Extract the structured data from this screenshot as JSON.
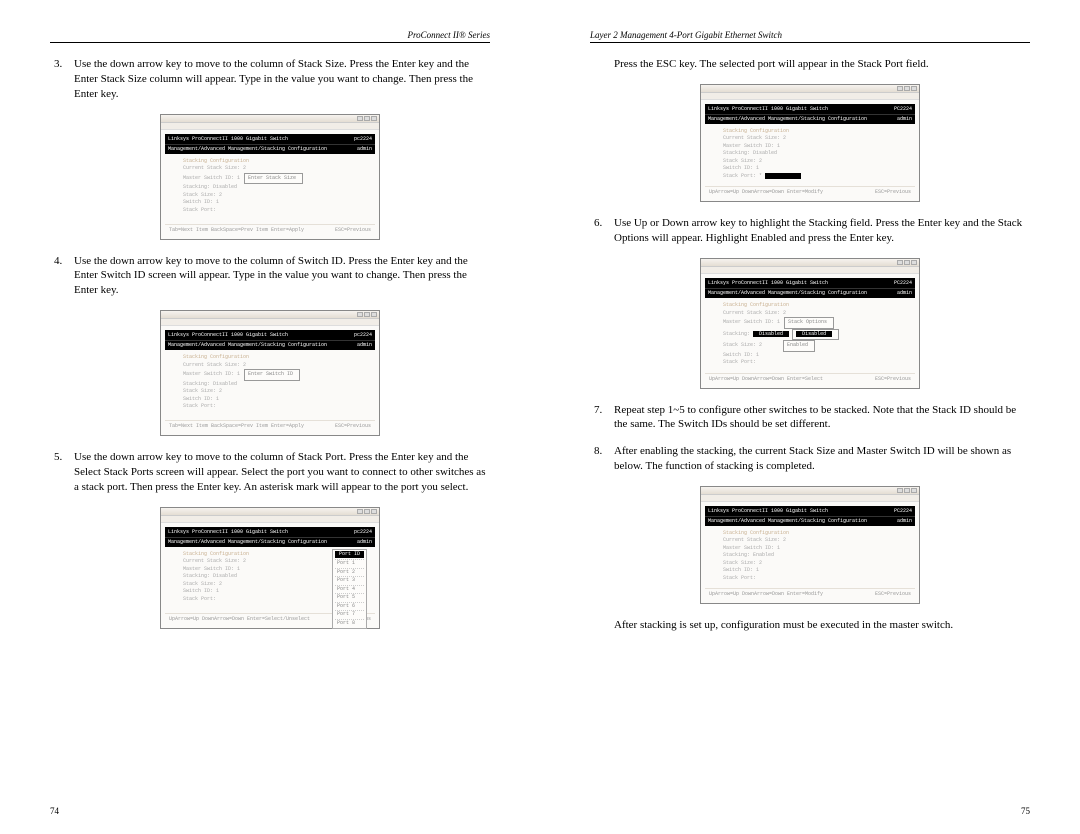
{
  "leftPage": {
    "header": "ProConnect II® Series",
    "pageNumber": "74",
    "steps": [
      {
        "n": "3.",
        "text": "Use the down arrow key to move to the column of Stack Size. Press the Enter key and the Enter Stack Size column will appear. Type in the value you want to change. Then press the Enter key."
      },
      {
        "n": "4.",
        "text": "Use the down arrow key to move to the column of Switch ID. Press the Enter key and the Enter Switch ID screen will appear. Type in the value you want to change. Then press the Enter key."
      },
      {
        "n": "5.",
        "text": "Use the down arrow key to move to the column of Stack Port. Press the Enter key and the Select Stack Ports screen will appear. Select the port you want to connect to other switches as a stack port. Then press the Enter key. An asterisk mark will appear to the port you select."
      }
    ],
    "screens": {
      "s3": {
        "titleLeft": "Linksys ProConnectII 1000 Gigabit Switch",
        "titleRight": "pc2224",
        "sub": "Management/Advanced Management/Stacking Configuration",
        "subRight": "admin",
        "heading": "Stacking Configuration",
        "lines": [
          "Current Stack Size: 2",
          "Master Switch ID:  1"
        ],
        "popup": "Enter Stack Size",
        "lines2": [
          "Stacking: Disabled",
          "Stack Size: 2",
          "Switch ID: 1",
          "Stack Port:"
        ],
        "footLeft": "Tab=Next Item  BackSpace=Prev Item  Enter=Apply",
        "footRight": "ESC=Previous"
      },
      "s4": {
        "titleLeft": "Linksys ProConnectII 1000 Gigabit Switch",
        "titleRight": "pc2224",
        "sub": "Management/Advanced Management/Stacking Configuration",
        "subRight": "admin",
        "heading": "Stacking Configuration",
        "lines": [
          "Current Stack Size: 2",
          "Master Switch ID:  1"
        ],
        "popup": "Enter Switch ID",
        "lines2": [
          "Stacking: Disabled",
          "Stack Size: 2",
          "Switch ID: 1",
          "Stack Port:"
        ],
        "footLeft": "Tab=Next Item  BackSpace=Prev Item  Enter=Apply",
        "footRight": "ESC=Previous"
      },
      "s5": {
        "titleLeft": "Linksys ProConnectII 1000 Gigabit Switch",
        "titleRight": "pc2224",
        "sub": "Management/Advanced Management/Stacking Configuration",
        "subRight": "admin",
        "heading": "Stacking Configuration",
        "lines": [
          "Current Stack Size: 2",
          "Master Switch ID:  1"
        ],
        "lines2": [
          "Stacking: Disabled",
          "Stack Size: 2",
          "Switch ID: 1",
          "Stack Port:"
        ],
        "portHeader": "Port ID",
        "ports": [
          "Port 1",
          "Port 2",
          "Port 3",
          "Port 4",
          "Port 5",
          "Port 6",
          "Port 7",
          "Port 8"
        ],
        "footLeft": "UpArrow=Up  DownArrow=Down  Enter=Select/Unselect",
        "footRight": "ESC=Previous"
      }
    }
  },
  "rightPage": {
    "header": "Layer 2 Management 4-Port Gigabit Ethernet Switch",
    "pageNumber": "75",
    "introPara": "Press the ESC key. The selected port will appear in the Stack Port field.",
    "steps": [
      {
        "n": "6.",
        "text": "Use Up or Down arrow key to highlight the Stacking field. Press the Enter key and the Stack Options will appear. Highlight Enabled and press the Enter key."
      },
      {
        "n": "7.",
        "text": "Repeat step 1~5 to configure other switches to be stacked. Note that the Stack ID should be the same. The Switch IDs should be set different."
      },
      {
        "n": "8.",
        "text": "After enabling the stacking, the current Stack Size and Master Switch ID will be shown as below. The function of stacking is completed."
      }
    ],
    "afterPara": "After stacking is set up, configuration must be executed in the master switch.",
    "screens": {
      "sA": {
        "titleLeft": "Linksys ProConnectII 1000 Gigabit Switch",
        "titleRight": "PC2224",
        "sub": "Management/Advanced Management/Stacking Configuration",
        "subRight": "admin",
        "heading": "Stacking Configuration",
        "lines": [
          "Current Stack Size: 2",
          "Master Switch ID:  1"
        ],
        "lines2": [
          "Stacking: Disabled",
          "Stack Size: 2",
          "Switch ID: 1",
          "Stack Port: *"
        ],
        "footLeft": "UpArrow=Up  DownArrow=Down  Enter=Modify",
        "footRight": "ESC=Previous"
      },
      "s6": {
        "titleLeft": "Linksys ProConnectII 1000 Gigabit Switch",
        "titleRight": "PC2224",
        "sub": "Management/Advanced Management/Stacking Configuration",
        "subRight": "admin",
        "heading": "Stacking Configuration",
        "lines": [
          "Current Stack Size: 2",
          "Master Switch ID:  1"
        ],
        "popupTitle": "Stack Options",
        "opt1": "Disabled",
        "opt2": "Enabled",
        "lines2": [
          "Stacking:",
          "Stack Size: 2",
          "Switch ID: 1",
          "Stack Port:"
        ],
        "footLeft": "UpArrow=Up  DownArrow=Down  Enter=Select",
        "footRight": "ESC=Previous"
      },
      "s8": {
        "titleLeft": "Linksys ProConnectII 1000 Gigabit Switch",
        "titleRight": "PC2224",
        "sub": "Management/Advanced Management/Stacking Configuration",
        "subRight": "admin",
        "heading": "Stacking Configuration",
        "lines": [
          "Current Stack Size: 2",
          "Master Switch ID:  1"
        ],
        "lines2": [
          "Stacking: Enabled",
          "Stack Size: 2",
          "Switch ID: 1",
          "Stack Port:"
        ],
        "footLeft": "UpArrow=Up  DownArrow=Down  Enter=Modify",
        "footRight": "ESC=Previous"
      }
    }
  }
}
